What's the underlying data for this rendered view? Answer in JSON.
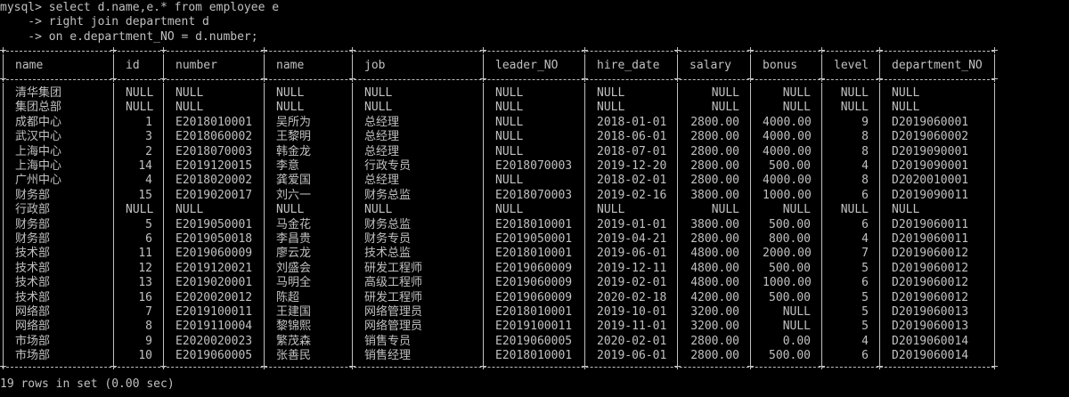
{
  "terminal": {
    "query_lines": [
      "mysql> select d.name,e.* from employee e",
      "    -> right join department d",
      "    -> on e.department_NO = d.number;"
    ],
    "columns": [
      "name",
      "id",
      "number",
      "name",
      "job",
      "leader_NO",
      "hire_date",
      "salary",
      "bonus",
      "level",
      "department_NO"
    ],
    "rows": [
      [
        "清华集团",
        "NULL",
        "NULL",
        "NULL",
        "NULL",
        "NULL",
        "NULL",
        "NULL",
        "NULL",
        "NULL",
        "NULL"
      ],
      [
        "集团总部",
        "NULL",
        "NULL",
        "NULL",
        "NULL",
        "NULL",
        "NULL",
        "NULL",
        "NULL",
        "NULL",
        "NULL"
      ],
      [
        "成都中心",
        "1",
        "E2018010001",
        "吴所为",
        "总经理",
        "NULL",
        "2018-01-01",
        "2800.00",
        "4000.00",
        "9",
        "D2019060001"
      ],
      [
        "武汉中心",
        "3",
        "E2018060002",
        "王黎明",
        "总经理",
        "NULL",
        "2018-06-01",
        "2800.00",
        "4000.00",
        "8",
        "D2019060002"
      ],
      [
        "上海中心",
        "2",
        "E2018070003",
        "韩金龙",
        "总经理",
        "NULL",
        "2018-07-01",
        "2800.00",
        "4000.00",
        "8",
        "D2019090001"
      ],
      [
        "上海中心",
        "14",
        "E2019120015",
        "李意",
        "行政专员",
        "E2018070003",
        "2019-12-20",
        "2800.00",
        "500.00",
        "4",
        "D2019090001"
      ],
      [
        "广州中心",
        "4",
        "E2018020002",
        "龚爱国",
        "总经理",
        "NULL",
        "2018-02-01",
        "2800.00",
        "4000.00",
        "8",
        "D2020010001"
      ],
      [
        "财务部",
        "15",
        "E2019020017",
        "刘六一",
        "财务总监",
        "E2018070003",
        "2019-02-16",
        "3800.00",
        "1000.00",
        "6",
        "D2019090011"
      ],
      [
        "行政部",
        "NULL",
        "NULL",
        "NULL",
        "NULL",
        "NULL",
        "NULL",
        "NULL",
        "NULL",
        "NULL",
        "NULL"
      ],
      [
        "财务部",
        "5",
        "E2019050001",
        "马金花",
        "财务总监",
        "E2018010001",
        "2019-01-01",
        "3800.00",
        "500.00",
        "6",
        "D2019060011"
      ],
      [
        "财务部",
        "6",
        "E2019050018",
        "李昌贵",
        "财务专员",
        "E2019050001",
        "2019-04-21",
        "2800.00",
        "800.00",
        "4",
        "D2019060011"
      ],
      [
        "技术部",
        "11",
        "E2019060009",
        "廖云龙",
        "技术总监",
        "E2018010001",
        "2019-06-01",
        "4800.00",
        "2000.00",
        "7",
        "D2019060012"
      ],
      [
        "技术部",
        "12",
        "E2019120021",
        "刘盛会",
        "研发工程师",
        "E2019060009",
        "2019-12-11",
        "4800.00",
        "500.00",
        "5",
        "D2019060012"
      ],
      [
        "技术部",
        "13",
        "E2019020001",
        "马明全",
        "高级工程师",
        "E2019060009",
        "2019-02-01",
        "4800.00",
        "1000.00",
        "6",
        "D2019060012"
      ],
      [
        "技术部",
        "16",
        "E2020020012",
        "陈超",
        "研发工程师",
        "E2019060009",
        "2020-02-18",
        "4200.00",
        "500.00",
        "5",
        "D2019060012"
      ],
      [
        "网络部",
        "7",
        "E2019100011",
        "王建国",
        "网络管理员",
        "E2018010001",
        "2019-10-01",
        "3200.00",
        "NULL",
        "5",
        "D2019060013"
      ],
      [
        "网络部",
        "8",
        "E2019110004",
        "黎锦熙",
        "网络管理员",
        "E2019100011",
        "2019-11-01",
        "3200.00",
        "NULL",
        "5",
        "D2019060013"
      ],
      [
        "市场部",
        "9",
        "E2020020023",
        "繁茂森",
        "销售专员",
        "E2019060005",
        "2020-02-01",
        "2800.00",
        "0.00",
        "4",
        "D2019060014"
      ],
      [
        "市场部",
        "10",
        "E2019060005",
        "张善民",
        "销售经理",
        "E2018010001",
        "2019-06-01",
        "2800.00",
        "500.00",
        "6",
        "D2019060014"
      ]
    ],
    "footer": "19 rows in set (0.00 sec)",
    "text_color": "#c0c0c0",
    "background_color": "#000000"
  }
}
